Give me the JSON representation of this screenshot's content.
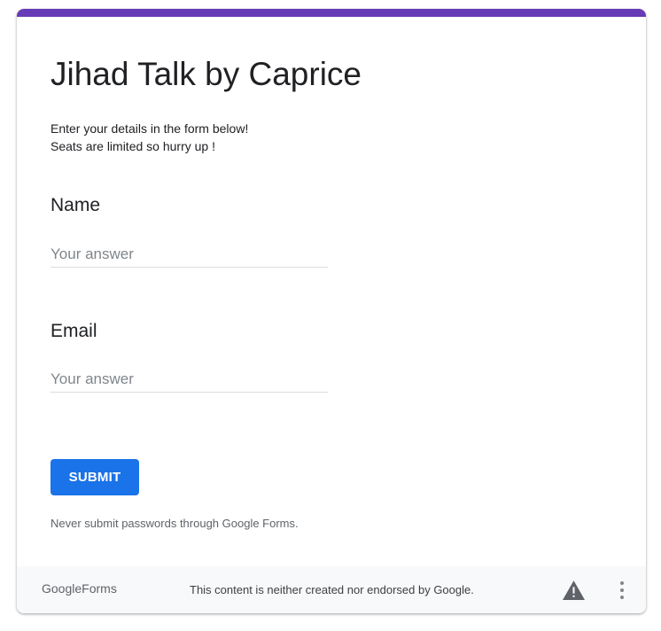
{
  "form": {
    "title": "Jihad Talk by Caprice",
    "description_lines": [
      "Enter your details in the form below!",
      "Seats are limited so hurry up !"
    ],
    "questions": [
      {
        "label": "Name",
        "placeholder": "Your answer",
        "value": ""
      },
      {
        "label": "Email",
        "placeholder": "Your answer",
        "value": ""
      }
    ],
    "submit_label": "SUBMIT",
    "password_warning": "Never submit passwords through Google Forms."
  },
  "footer": {
    "logo_google": "Google",
    "logo_forms": "Forms",
    "disclaimer": "This content is neither created nor endorsed by Google.",
    "report_icon": "warning-triangle-icon",
    "more_icon": "more-vertical-icon"
  },
  "colors": {
    "accent": "#673ab7",
    "submit": "#1a73e8",
    "footer_bg": "#f8f9fa"
  }
}
